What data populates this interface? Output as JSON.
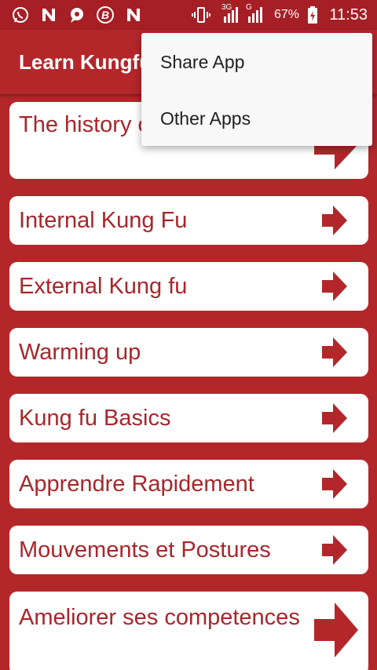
{
  "status_bar": {
    "icons": [
      "whatsapp-icon",
      "notification-n-icon",
      "chat-icon",
      "b-app-icon",
      "notification-n-icon",
      "vibrate-icon",
      "signal-icon",
      "battery-icon"
    ],
    "network_3g": "3G",
    "network_g": "G",
    "battery": "67%",
    "time": "11:53"
  },
  "app_bar": {
    "title": "Learn Kungfu"
  },
  "items": [
    {
      "label": "The history of Kungfu",
      "icon": "arrow-right-icon"
    },
    {
      "label": "Internal Kung Fu",
      "icon": "arrow-right-icon"
    },
    {
      "label": "External Kung fu",
      "icon": "arrow-right-icon"
    },
    {
      "label": "Warming up",
      "icon": "arrow-right-icon"
    },
    {
      "label": "Kung fu Basics",
      "icon": "arrow-right-icon"
    },
    {
      "label": "Apprendre Rapidement",
      "icon": "arrow-right-icon"
    },
    {
      "label": "Mouvements et Postures",
      "icon": "arrow-right-icon"
    },
    {
      "label": "Ameliorer ses competences",
      "icon": "arrow-right-icon"
    }
  ],
  "menu": {
    "items": [
      {
        "label": "Share App"
      },
      {
        "label": "Other Apps"
      }
    ]
  },
  "colors": {
    "primary": "#b3272b",
    "status_bar": "#a51f25",
    "text_accent": "#a8262b",
    "arrow": "#b3272b"
  }
}
